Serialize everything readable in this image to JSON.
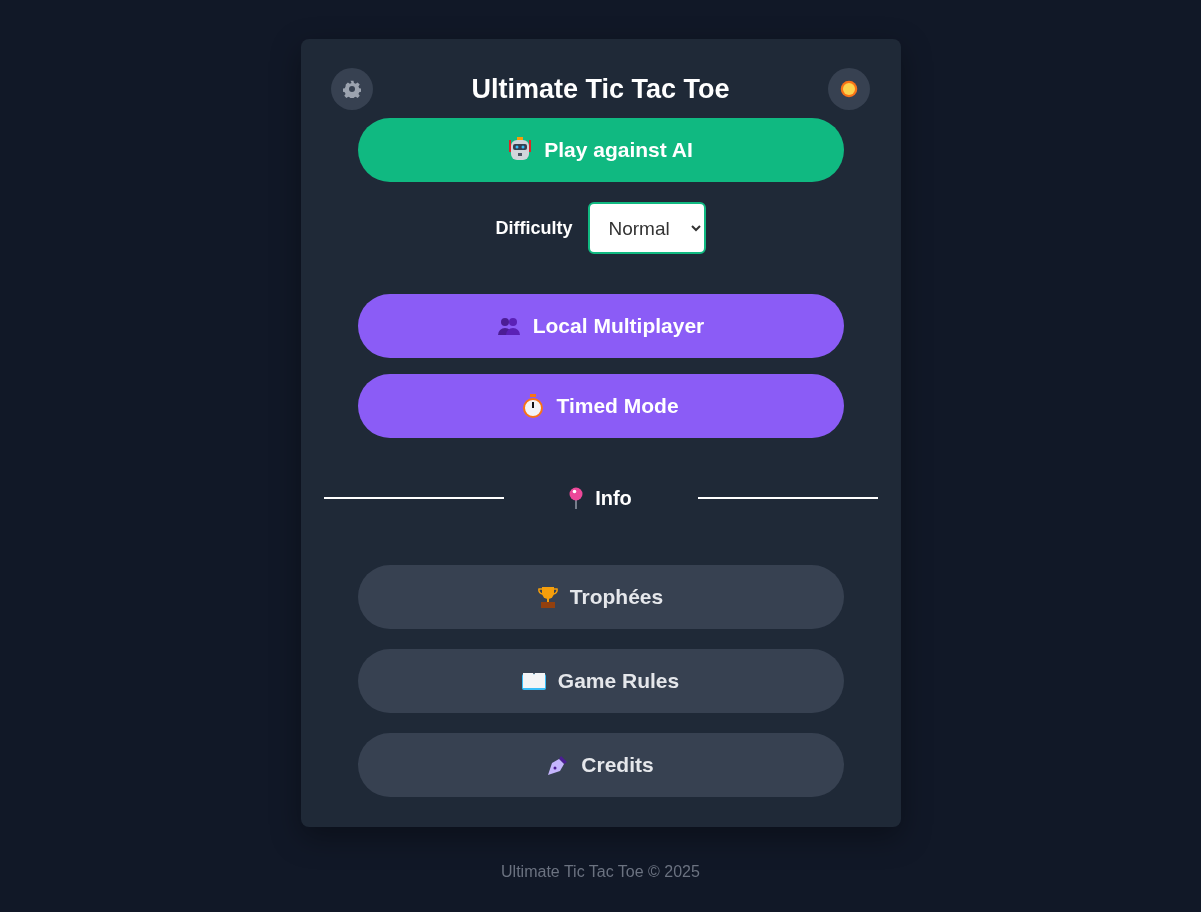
{
  "title": "Ultimate Tic Tac Toe",
  "header_buttons": [
    {
      "kind": "settings"
    },
    {
      "kind": "theme"
    }
  ],
  "mode_buttons": [
    {
      "label": "Play against AI",
      "kind": "accent"
    }
  ],
  "difficulty": {
    "label": "Difficulty",
    "value": "Normal"
  },
  "more_modes": [
    {
      "label": "Local Multiplayer",
      "kind": "primary"
    },
    {
      "label": "Timed Mode",
      "kind": "primary"
    }
  ],
  "section": {
    "label": "Info"
  },
  "info_buttons": [
    {
      "label": "Trophées",
      "kind": "secondary"
    },
    {
      "label": "Game Rules",
      "kind": "secondary"
    },
    {
      "label": "Credits",
      "kind": "secondary"
    }
  ],
  "footer": "Ultimate Tic Tac Toe © 2025"
}
